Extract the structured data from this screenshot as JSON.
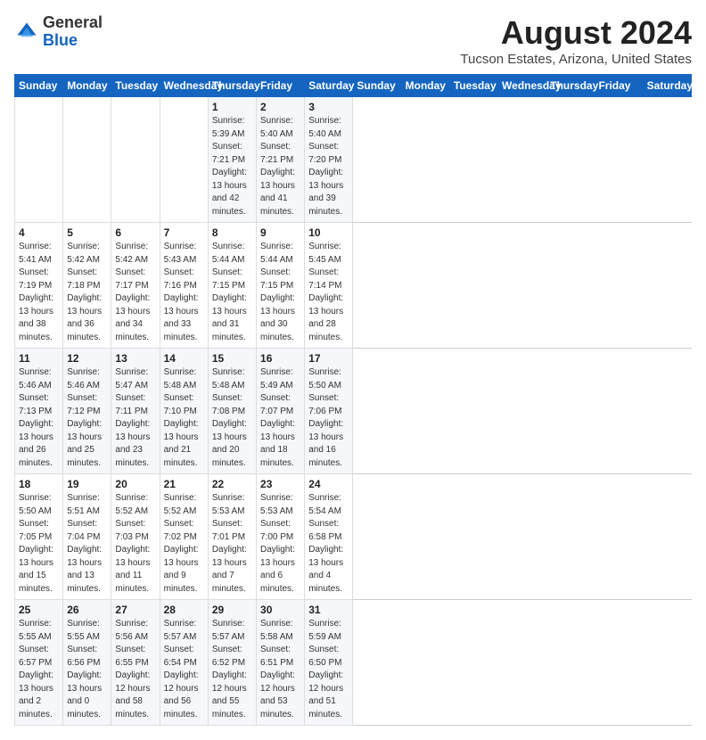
{
  "header": {
    "logo_general": "General",
    "logo_blue": "Blue",
    "month_year": "August 2024",
    "location": "Tucson Estates, Arizona, United States"
  },
  "days_of_week": [
    "Sunday",
    "Monday",
    "Tuesday",
    "Wednesday",
    "Thursday",
    "Friday",
    "Saturday"
  ],
  "weeks": [
    [
      {
        "day": "",
        "sunrise": "",
        "sunset": "",
        "daylight": ""
      },
      {
        "day": "",
        "sunrise": "",
        "sunset": "",
        "daylight": ""
      },
      {
        "day": "",
        "sunrise": "",
        "sunset": "",
        "daylight": ""
      },
      {
        "day": "",
        "sunrise": "",
        "sunset": "",
        "daylight": ""
      },
      {
        "day": "1",
        "sunrise": "Sunrise: 5:39 AM",
        "sunset": "Sunset: 7:21 PM",
        "daylight": "Daylight: 13 hours and 42 minutes."
      },
      {
        "day": "2",
        "sunrise": "Sunrise: 5:40 AM",
        "sunset": "Sunset: 7:21 PM",
        "daylight": "Daylight: 13 hours and 41 minutes."
      },
      {
        "day": "3",
        "sunrise": "Sunrise: 5:40 AM",
        "sunset": "Sunset: 7:20 PM",
        "daylight": "Daylight: 13 hours and 39 minutes."
      }
    ],
    [
      {
        "day": "4",
        "sunrise": "Sunrise: 5:41 AM",
        "sunset": "Sunset: 7:19 PM",
        "daylight": "Daylight: 13 hours and 38 minutes."
      },
      {
        "day": "5",
        "sunrise": "Sunrise: 5:42 AM",
        "sunset": "Sunset: 7:18 PM",
        "daylight": "Daylight: 13 hours and 36 minutes."
      },
      {
        "day": "6",
        "sunrise": "Sunrise: 5:42 AM",
        "sunset": "Sunset: 7:17 PM",
        "daylight": "Daylight: 13 hours and 34 minutes."
      },
      {
        "day": "7",
        "sunrise": "Sunrise: 5:43 AM",
        "sunset": "Sunset: 7:16 PM",
        "daylight": "Daylight: 13 hours and 33 minutes."
      },
      {
        "day": "8",
        "sunrise": "Sunrise: 5:44 AM",
        "sunset": "Sunset: 7:15 PM",
        "daylight": "Daylight: 13 hours and 31 minutes."
      },
      {
        "day": "9",
        "sunrise": "Sunrise: 5:44 AM",
        "sunset": "Sunset: 7:15 PM",
        "daylight": "Daylight: 13 hours and 30 minutes."
      },
      {
        "day": "10",
        "sunrise": "Sunrise: 5:45 AM",
        "sunset": "Sunset: 7:14 PM",
        "daylight": "Daylight: 13 hours and 28 minutes."
      }
    ],
    [
      {
        "day": "11",
        "sunrise": "Sunrise: 5:46 AM",
        "sunset": "Sunset: 7:13 PM",
        "daylight": "Daylight: 13 hours and 26 minutes."
      },
      {
        "day": "12",
        "sunrise": "Sunrise: 5:46 AM",
        "sunset": "Sunset: 7:12 PM",
        "daylight": "Daylight: 13 hours and 25 minutes."
      },
      {
        "day": "13",
        "sunrise": "Sunrise: 5:47 AM",
        "sunset": "Sunset: 7:11 PM",
        "daylight": "Daylight: 13 hours and 23 minutes."
      },
      {
        "day": "14",
        "sunrise": "Sunrise: 5:48 AM",
        "sunset": "Sunset: 7:10 PM",
        "daylight": "Daylight: 13 hours and 21 minutes."
      },
      {
        "day": "15",
        "sunrise": "Sunrise: 5:48 AM",
        "sunset": "Sunset: 7:08 PM",
        "daylight": "Daylight: 13 hours and 20 minutes."
      },
      {
        "day": "16",
        "sunrise": "Sunrise: 5:49 AM",
        "sunset": "Sunset: 7:07 PM",
        "daylight": "Daylight: 13 hours and 18 minutes."
      },
      {
        "day": "17",
        "sunrise": "Sunrise: 5:50 AM",
        "sunset": "Sunset: 7:06 PM",
        "daylight": "Daylight: 13 hours and 16 minutes."
      }
    ],
    [
      {
        "day": "18",
        "sunrise": "Sunrise: 5:50 AM",
        "sunset": "Sunset: 7:05 PM",
        "daylight": "Daylight: 13 hours and 15 minutes."
      },
      {
        "day": "19",
        "sunrise": "Sunrise: 5:51 AM",
        "sunset": "Sunset: 7:04 PM",
        "daylight": "Daylight: 13 hours and 13 minutes."
      },
      {
        "day": "20",
        "sunrise": "Sunrise: 5:52 AM",
        "sunset": "Sunset: 7:03 PM",
        "daylight": "Daylight: 13 hours and 11 minutes."
      },
      {
        "day": "21",
        "sunrise": "Sunrise: 5:52 AM",
        "sunset": "Sunset: 7:02 PM",
        "daylight": "Daylight: 13 hours and 9 minutes."
      },
      {
        "day": "22",
        "sunrise": "Sunrise: 5:53 AM",
        "sunset": "Sunset: 7:01 PM",
        "daylight": "Daylight: 13 hours and 7 minutes."
      },
      {
        "day": "23",
        "sunrise": "Sunrise: 5:53 AM",
        "sunset": "Sunset: 7:00 PM",
        "daylight": "Daylight: 13 hours and 6 minutes."
      },
      {
        "day": "24",
        "sunrise": "Sunrise: 5:54 AM",
        "sunset": "Sunset: 6:58 PM",
        "daylight": "Daylight: 13 hours and 4 minutes."
      }
    ],
    [
      {
        "day": "25",
        "sunrise": "Sunrise: 5:55 AM",
        "sunset": "Sunset: 6:57 PM",
        "daylight": "Daylight: 13 hours and 2 minutes."
      },
      {
        "day": "26",
        "sunrise": "Sunrise: 5:55 AM",
        "sunset": "Sunset: 6:56 PM",
        "daylight": "Daylight: 13 hours and 0 minutes."
      },
      {
        "day": "27",
        "sunrise": "Sunrise: 5:56 AM",
        "sunset": "Sunset: 6:55 PM",
        "daylight": "Daylight: 12 hours and 58 minutes."
      },
      {
        "day": "28",
        "sunrise": "Sunrise: 5:57 AM",
        "sunset": "Sunset: 6:54 PM",
        "daylight": "Daylight: 12 hours and 56 minutes."
      },
      {
        "day": "29",
        "sunrise": "Sunrise: 5:57 AM",
        "sunset": "Sunset: 6:52 PM",
        "daylight": "Daylight: 12 hours and 55 minutes."
      },
      {
        "day": "30",
        "sunrise": "Sunrise: 5:58 AM",
        "sunset": "Sunset: 6:51 PM",
        "daylight": "Daylight: 12 hours and 53 minutes."
      },
      {
        "day": "31",
        "sunrise": "Sunrise: 5:59 AM",
        "sunset": "Sunset: 6:50 PM",
        "daylight": "Daylight: 12 hours and 51 minutes."
      }
    ]
  ]
}
